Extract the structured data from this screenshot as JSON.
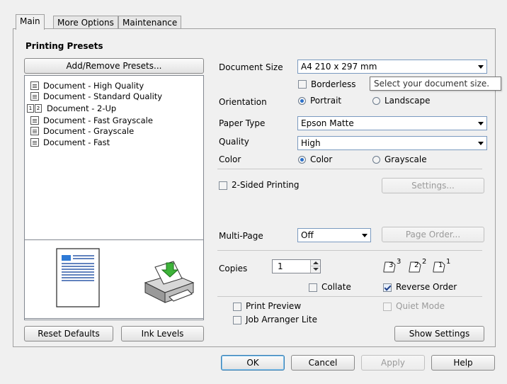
{
  "tabs": [
    {
      "label": "Main",
      "active": true
    },
    {
      "label": "More Options",
      "active": false
    },
    {
      "label": "Maintenance",
      "active": false
    }
  ],
  "presets": {
    "title": "Printing Presets",
    "add_remove_label": "Add/Remove Presets...",
    "items": [
      "Document - High Quality",
      "Document - Standard Quality",
      "Document - 2-Up",
      "Document - Fast Grayscale",
      "Document - Grayscale",
      "Document - Fast"
    ]
  },
  "form": {
    "document_size_label": "Document Size",
    "document_size_value": "A4 210 x 297 mm",
    "borderless_label": "Borderless",
    "borderless_checked": false,
    "tooltip": "Select your document size.",
    "orientation_label": "Orientation",
    "portrait_label": "Portrait",
    "landscape_label": "Landscape",
    "orientation_selected": "Portrait",
    "paper_type_label": "Paper Type",
    "paper_type_value": "Epson Matte",
    "quality_label": "Quality",
    "quality_value": "High",
    "color_label": "Color",
    "color_option": "Color",
    "grayscale_option": "Grayscale",
    "color_selected": "Color",
    "two_sided_label": "2-Sided Printing",
    "two_sided_checked": false,
    "settings_label": "Settings...",
    "multipage_label": "Multi-Page",
    "multipage_value": "Off",
    "page_order_label": "Page Order...",
    "copies_label": "Copies",
    "copies_value": "1",
    "collate_label": "Collate",
    "collate_checked": false,
    "reverse_order_label": "Reverse Order",
    "reverse_order_checked": true,
    "print_preview_label": "Print Preview",
    "job_arranger_label": "Job Arranger Lite",
    "quiet_mode_label": "Quiet Mode",
    "show_settings_label": "Show Settings",
    "page_stack_numbers": [
      "3",
      "2",
      "1"
    ]
  },
  "bottom_left": {
    "reset_defaults_label": "Reset Defaults",
    "ink_levels_label": "Ink Levels"
  },
  "dialog_buttons": {
    "ok": "OK",
    "cancel": "Cancel",
    "apply": "Apply",
    "help": "Help"
  },
  "colors": {
    "accent": "#2a6fc9",
    "panel": "#f0f0f0",
    "border": "#a0a0a0"
  }
}
